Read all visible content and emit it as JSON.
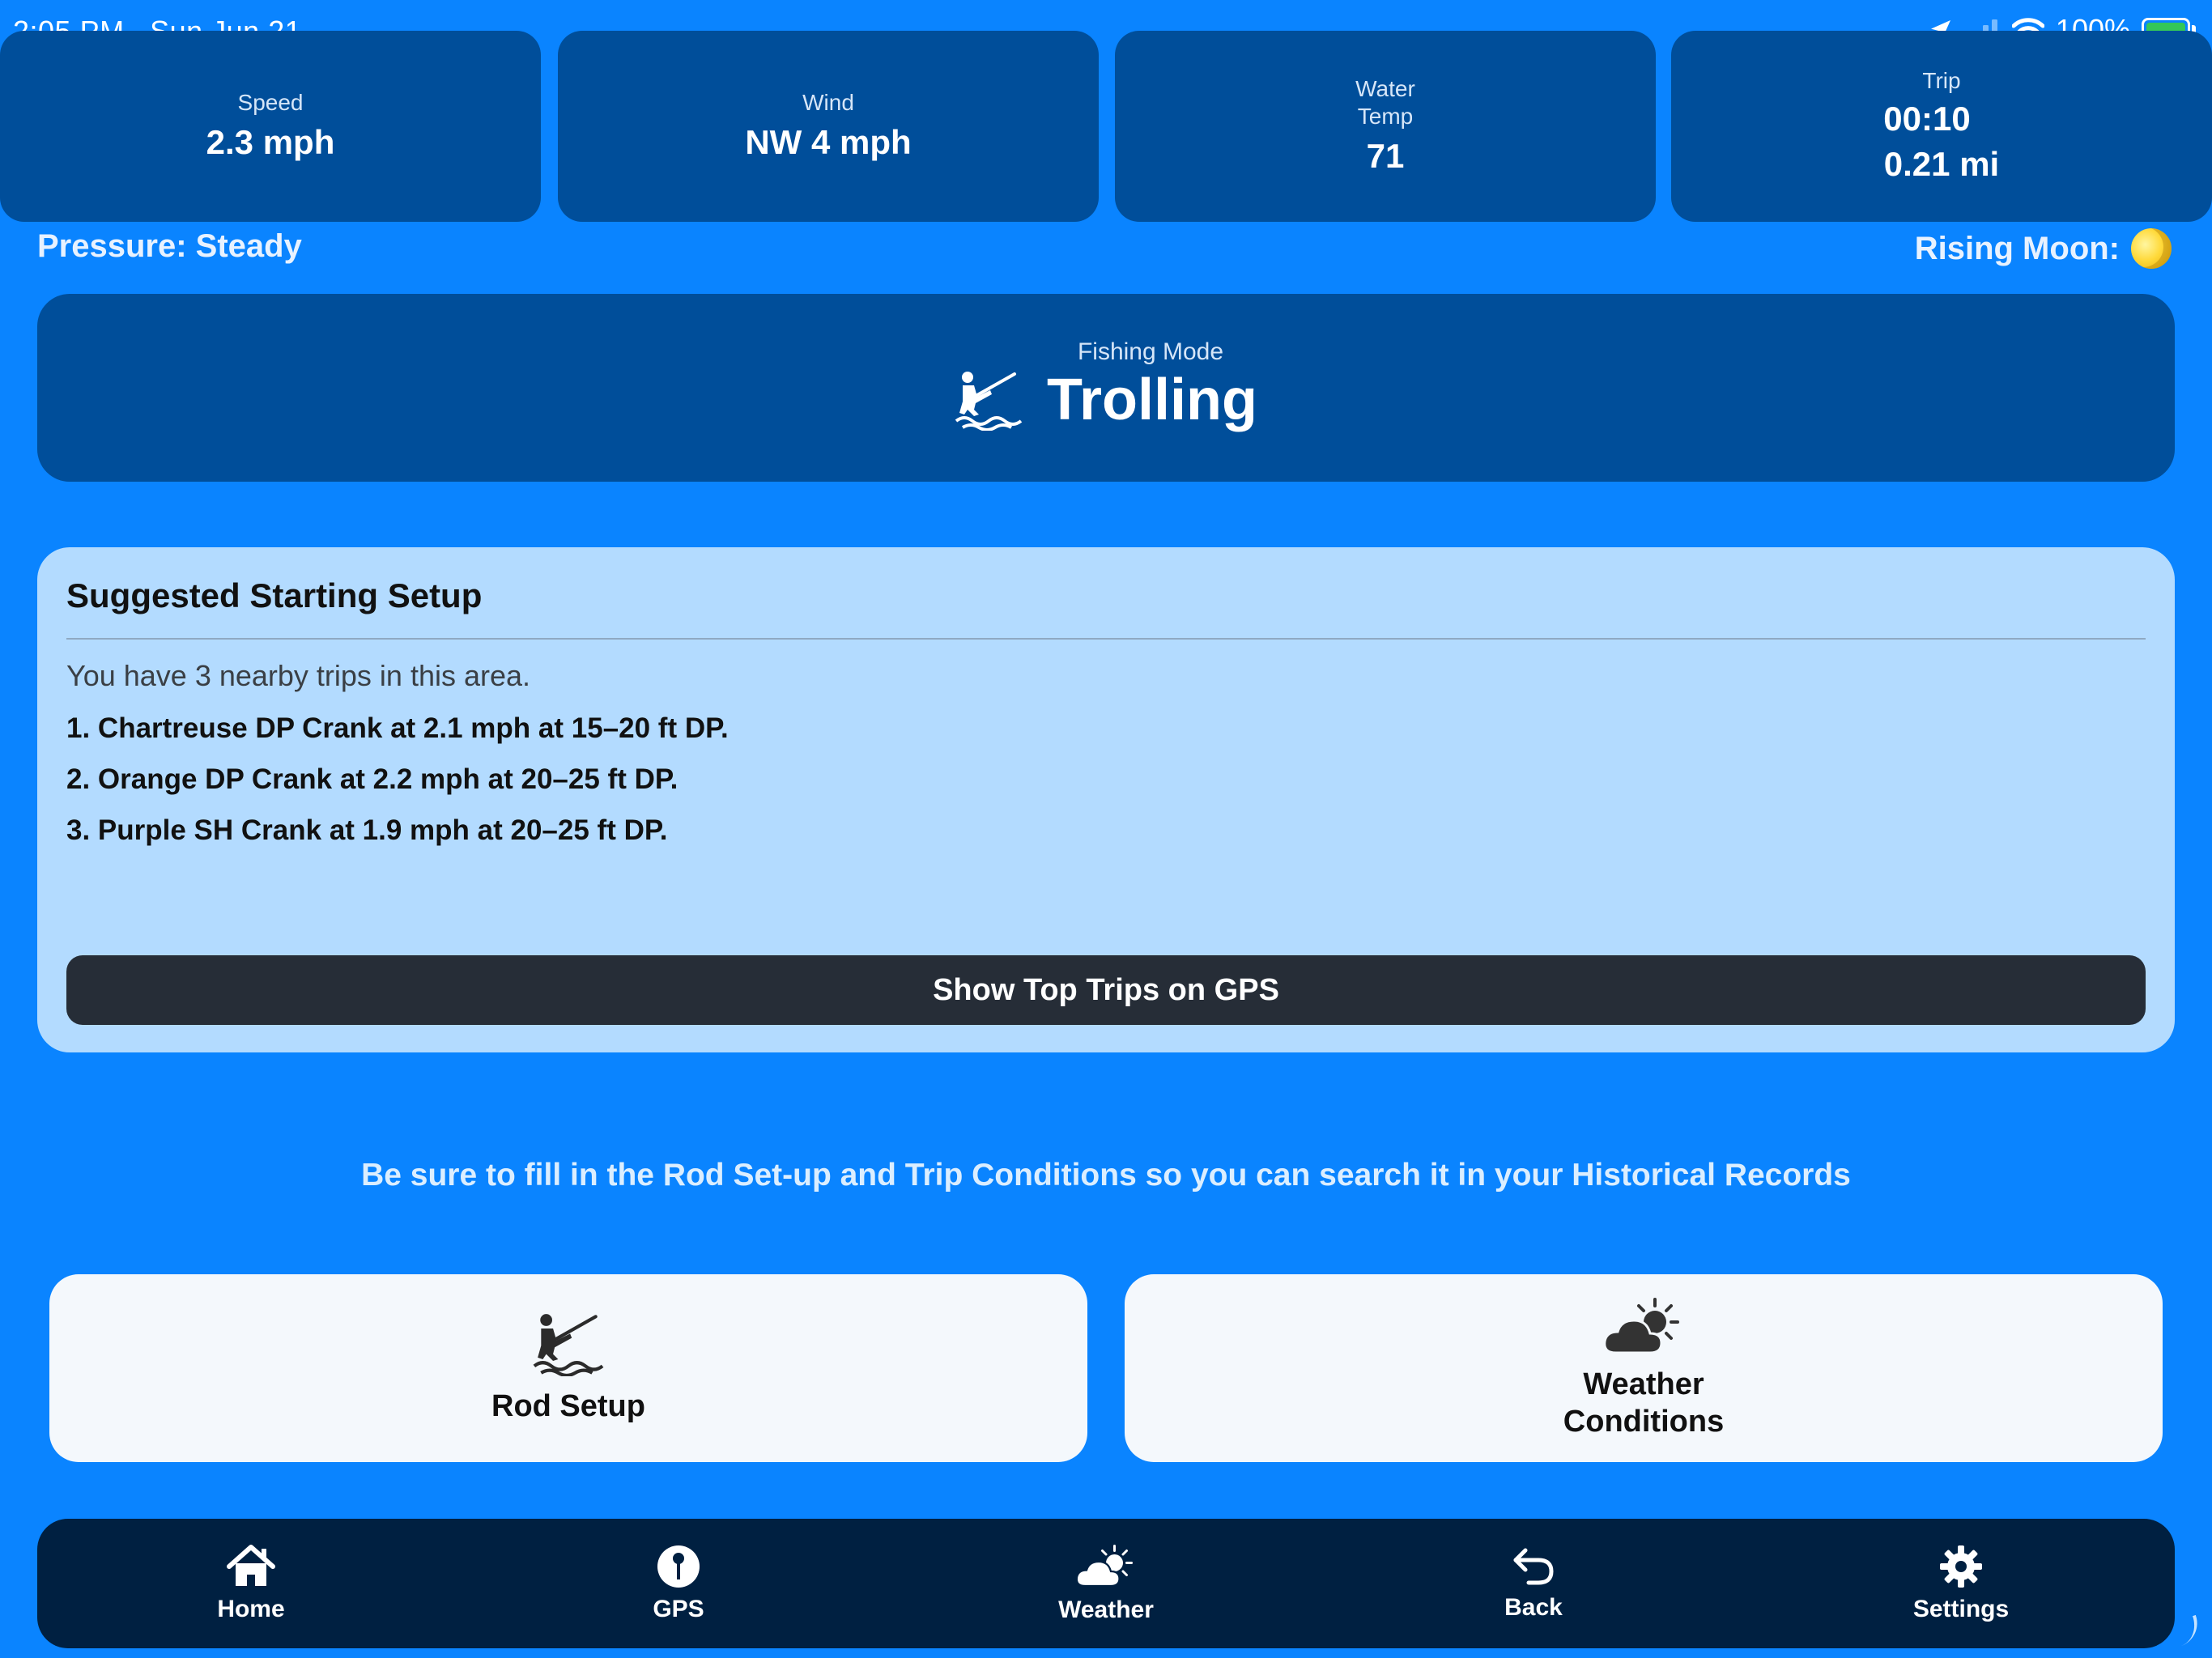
{
  "status_bar": {
    "time": "2:05 PM",
    "date": "Sun Jun 21",
    "battery": "100%"
  },
  "metrics": {
    "speed": {
      "label": "Speed",
      "value": "2.3 mph"
    },
    "wind": {
      "label": "Wind",
      "value": "NW 4 mph"
    },
    "water_temp": {
      "label_line1": "Water",
      "label_line2": "Temp",
      "value": "71"
    },
    "trip": {
      "label": "Trip",
      "time": "00:10",
      "distance": "0.21 mi"
    }
  },
  "pressure": "Pressure: Steady",
  "moon": "Rising Moon:",
  "fishing_mode": {
    "label": "Fishing Mode",
    "value": "Trolling"
  },
  "setup": {
    "title": "Suggested Starting Setup",
    "intro": "You have 3 nearby trips in this area.",
    "items": [
      "1. Chartreuse DP Crank at 2.1 mph at 15–20 ft DP.",
      "2. Orange DP Crank at 2.2 mph at 20–25 ft DP.",
      "3. Purple SH Crank at 1.9 mph at 20–25 ft DP."
    ],
    "button": "Show Top Trips on GPS"
  },
  "reminder": "Be sure to fill in the Rod Set-up and Trip Conditions so you can search it in your Historical Records",
  "actions": {
    "rod_setup": {
      "label": "Rod Setup",
      "icon": "fisherman-icon"
    },
    "weather": {
      "label": "Weather\nConditions",
      "icon": "partly-cloudy-icon"
    }
  },
  "tabs": [
    {
      "label": "Home",
      "icon": "house-icon"
    },
    {
      "label": "GPS",
      "icon": "map-pin-icon"
    },
    {
      "label": "Weather",
      "icon": "partly-cloudy-icon"
    },
    {
      "label": "Back",
      "icon": "back-arrow-icon"
    },
    {
      "label": "Settings",
      "icon": "gear-icon"
    }
  ],
  "colors": {
    "background": "#0A84FF",
    "card_dark": "#004E9A",
    "setup_panel": "#B3DBFF",
    "button_dark": "#262D37",
    "tabbar": "#002041"
  }
}
